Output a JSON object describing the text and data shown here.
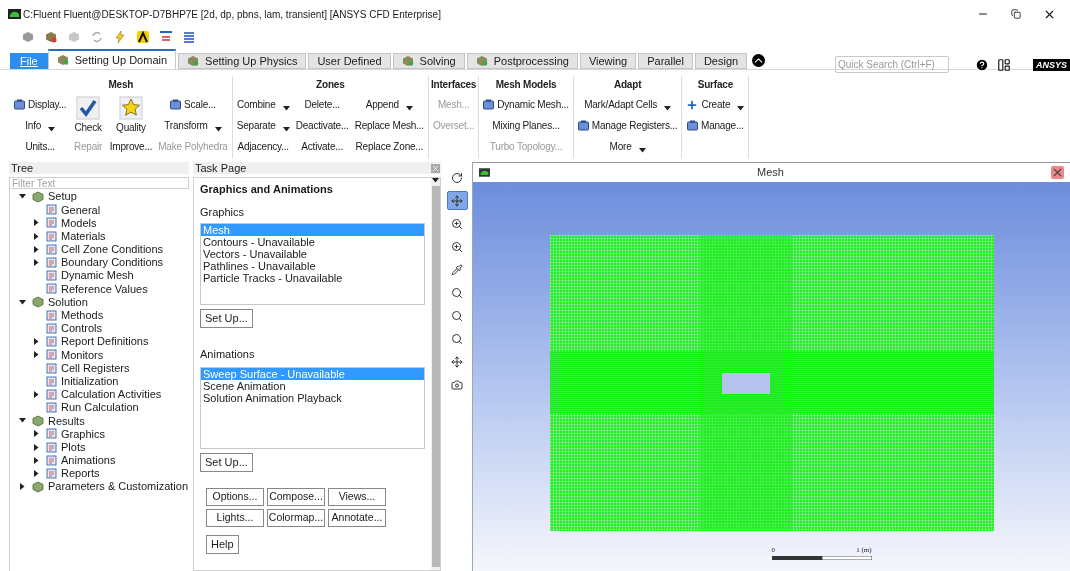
{
  "window": {
    "title": "C:Fluent Fluent@DESKTOP-D7BHP7E  [2d, dp, pbns, lam, transient] [ANSYS CFD Enterprise]"
  },
  "file_menu": "File",
  "tabs": [
    {
      "label": "Setting Up Domain",
      "selected": true,
      "kind": "icon"
    },
    {
      "label": "Setting Up Physics",
      "selected": false,
      "kind": "icon"
    },
    {
      "label": "User Defined",
      "selected": false,
      "kind": "plain"
    },
    {
      "label": "Solving",
      "selected": false,
      "kind": "icon"
    },
    {
      "label": "Postprocessing",
      "selected": false,
      "kind": "icon"
    },
    {
      "label": "Viewing",
      "selected": false,
      "kind": "plain"
    },
    {
      "label": "Parallel",
      "selected": false,
      "kind": "plain"
    },
    {
      "label": "Design",
      "selected": false,
      "kind": "plain"
    }
  ],
  "quick_search": {
    "placeholder": "Quick Search (Ctrl+F)"
  },
  "logo": "ANSYS",
  "ribbon": [
    {
      "title": "Mesh",
      "columns": [
        {
          "kind": "small",
          "items": [
            {
              "label": "Display...",
              "kind": "icon",
              "disabled": false,
              "dropdown": false
            },
            {
              "label": "Info",
              "kind": "plain",
              "disabled": false,
              "dropdown": true
            },
            {
              "label": "Units...",
              "kind": "plain",
              "disabled": false,
              "dropdown": false
            }
          ]
        },
        {
          "kind": "large",
          "items": [
            {
              "label": "Check",
              "disabled": false
            },
            {
              "label": "Repair",
              "kind": "plain",
              "disabled": true,
              "dropdown": false
            }
          ]
        },
        {
          "kind": "large",
          "items": [
            {
              "label": "Quality",
              "disabled": false
            },
            {
              "label": "Improve...",
              "kind": "plain",
              "disabled": false,
              "dropdown": false
            }
          ]
        },
        {
          "kind": "small",
          "items": [
            {
              "label": "Scale...",
              "kind": "icon",
              "disabled": false,
              "dropdown": false
            },
            {
              "label": "Transform",
              "kind": "plain",
              "disabled": false,
              "dropdown": true
            },
            {
              "label": "Make Polyhedra",
              "kind": "plain",
              "disabled": true,
              "dropdown": false
            }
          ]
        }
      ]
    },
    {
      "title": "Zones",
      "columns": [
        {
          "kind": "small",
          "items": [
            {
              "label": "Combine",
              "kind": "plain",
              "disabled": false,
              "dropdown": true
            },
            {
              "label": "Separate",
              "kind": "plain",
              "disabled": false,
              "dropdown": true
            },
            {
              "label": "Adjacency...",
              "kind": "plain",
              "disabled": false,
              "dropdown": false
            }
          ]
        },
        {
          "kind": "small",
          "items": [
            {
              "label": "Delete...",
              "kind": "plain",
              "disabled": false,
              "dropdown": false
            },
            {
              "label": "Deactivate...",
              "kind": "plain",
              "disabled": false,
              "dropdown": false
            },
            {
              "label": "Activate...",
              "kind": "plain",
              "disabled": false,
              "dropdown": false
            }
          ]
        },
        {
          "kind": "small",
          "items": [
            {
              "label": "Append",
              "kind": "plain",
              "disabled": false,
              "dropdown": true
            },
            {
              "label": "Replace Mesh...",
              "kind": "plain",
              "disabled": false,
              "dropdown": false
            },
            {
              "label": "Replace Zone...",
              "kind": "plain",
              "disabled": false,
              "dropdown": false
            }
          ]
        }
      ]
    },
    {
      "title": "Interfaces",
      "columns": [
        {
          "kind": "small",
          "items": [
            {
              "label": "Mesh...",
              "kind": "plain",
              "disabled": true,
              "dropdown": false
            },
            {
              "label": "Overset...",
              "kind": "plain",
              "disabled": true,
              "dropdown": false
            }
          ]
        }
      ]
    },
    {
      "title": "Mesh Models",
      "columns": [
        {
          "kind": "small",
          "items": [
            {
              "label": "Dynamic Mesh...",
              "kind": "icon",
              "disabled": false,
              "dropdown": false
            },
            {
              "label": "Mixing Planes...",
              "kind": "plain",
              "disabled": false,
              "dropdown": false
            },
            {
              "label": "Turbo Topology...",
              "kind": "plain",
              "disabled": true,
              "dropdown": false
            }
          ]
        }
      ]
    },
    {
      "title": "Adapt",
      "columns": [
        {
          "kind": "small",
          "items": [
            {
              "label": "Mark/Adapt Cells",
              "kind": "plain",
              "disabled": false,
              "dropdown": true
            },
            {
              "label": "Manage Registers...",
              "kind": "icon",
              "disabled": false,
              "dropdown": false
            },
            {
              "label": "More",
              "kind": "plain",
              "disabled": false,
              "dropdown": true
            }
          ]
        }
      ]
    },
    {
      "title": "Surface",
      "columns": [
        {
          "kind": "small",
          "items": [
            {
              "label": "Create",
              "kind": "plus",
              "disabled": false,
              "dropdown": true
            },
            {
              "label": "Manage...",
              "kind": "icon",
              "disabled": false,
              "dropdown": false
            }
          ]
        }
      ]
    }
  ],
  "tree": {
    "title": "Tree",
    "filter_placeholder": "Filter Text",
    "items": [
      {
        "label": "Setup",
        "expanded": true,
        "children": [
          {
            "label": "General"
          },
          {
            "label": "Models",
            "expanded": false
          },
          {
            "label": "Materials",
            "expanded": false
          },
          {
            "label": "Cell Zone Conditions",
            "expanded": false
          },
          {
            "label": "Boundary Conditions",
            "expanded": false
          },
          {
            "label": "Dynamic Mesh"
          },
          {
            "label": "Reference Values"
          }
        ]
      },
      {
        "label": "Solution",
        "expanded": true,
        "children": [
          {
            "label": "Methods"
          },
          {
            "label": "Controls"
          },
          {
            "label": "Report Definitions",
            "expanded": false
          },
          {
            "label": "Monitors",
            "expanded": false
          },
          {
            "label": "Cell Registers"
          },
          {
            "label": "Initialization"
          },
          {
            "label": "Calculation Activities",
            "expanded": false
          },
          {
            "label": "Run Calculation"
          }
        ]
      },
      {
        "label": "Results",
        "expanded": true,
        "children": [
          {
            "label": "Graphics",
            "expanded": false
          },
          {
            "label": "Plots",
            "expanded": false
          },
          {
            "label": "Animations",
            "expanded": false
          },
          {
            "label": "Reports",
            "expanded": false
          }
        ]
      },
      {
        "label": "Parameters & Customization",
        "expanded": false
      }
    ]
  },
  "task_page": {
    "title": "Task Page",
    "heading": "Graphics and Animations",
    "sections": [
      {
        "label": "Graphics",
        "items": [
          {
            "label": "Mesh",
            "selected": true
          },
          {
            "label": "Contours - Unavailable",
            "selected": false
          },
          {
            "label": "Vectors - Unavailable",
            "selected": false
          },
          {
            "label": "Pathlines - Unavailable",
            "selected": false
          },
          {
            "label": "Particle Tracks - Unavailable",
            "selected": false
          }
        ],
        "button": "Set Up..."
      },
      {
        "label": "Animations",
        "items": [
          {
            "label": "Sweep Surface - Unavailable",
            "selected": true
          },
          {
            "label": "Scene Animation",
            "selected": false
          },
          {
            "label": "Solution Animation Playback",
            "selected": false
          }
        ],
        "button": "Set Up..."
      }
    ],
    "buttons": [
      "Options...",
      "Compose...",
      "Views...",
      "Lights...",
      "Colormap...",
      "Annotate..."
    ],
    "help": "Help"
  },
  "graphics_tools": [
    {
      "selected": false
    },
    {
      "selected": true
    },
    {
      "selected": false
    },
    {
      "selected": false
    },
    {
      "selected": false
    },
    {
      "selected": false
    },
    {
      "selected": false
    },
    {
      "selected": false
    },
    {
      "selected": false
    },
    {
      "selected": false
    }
  ],
  "graphics_window": {
    "title": "Mesh",
    "scale_start": "0",
    "scale_end": "1 (m)"
  }
}
